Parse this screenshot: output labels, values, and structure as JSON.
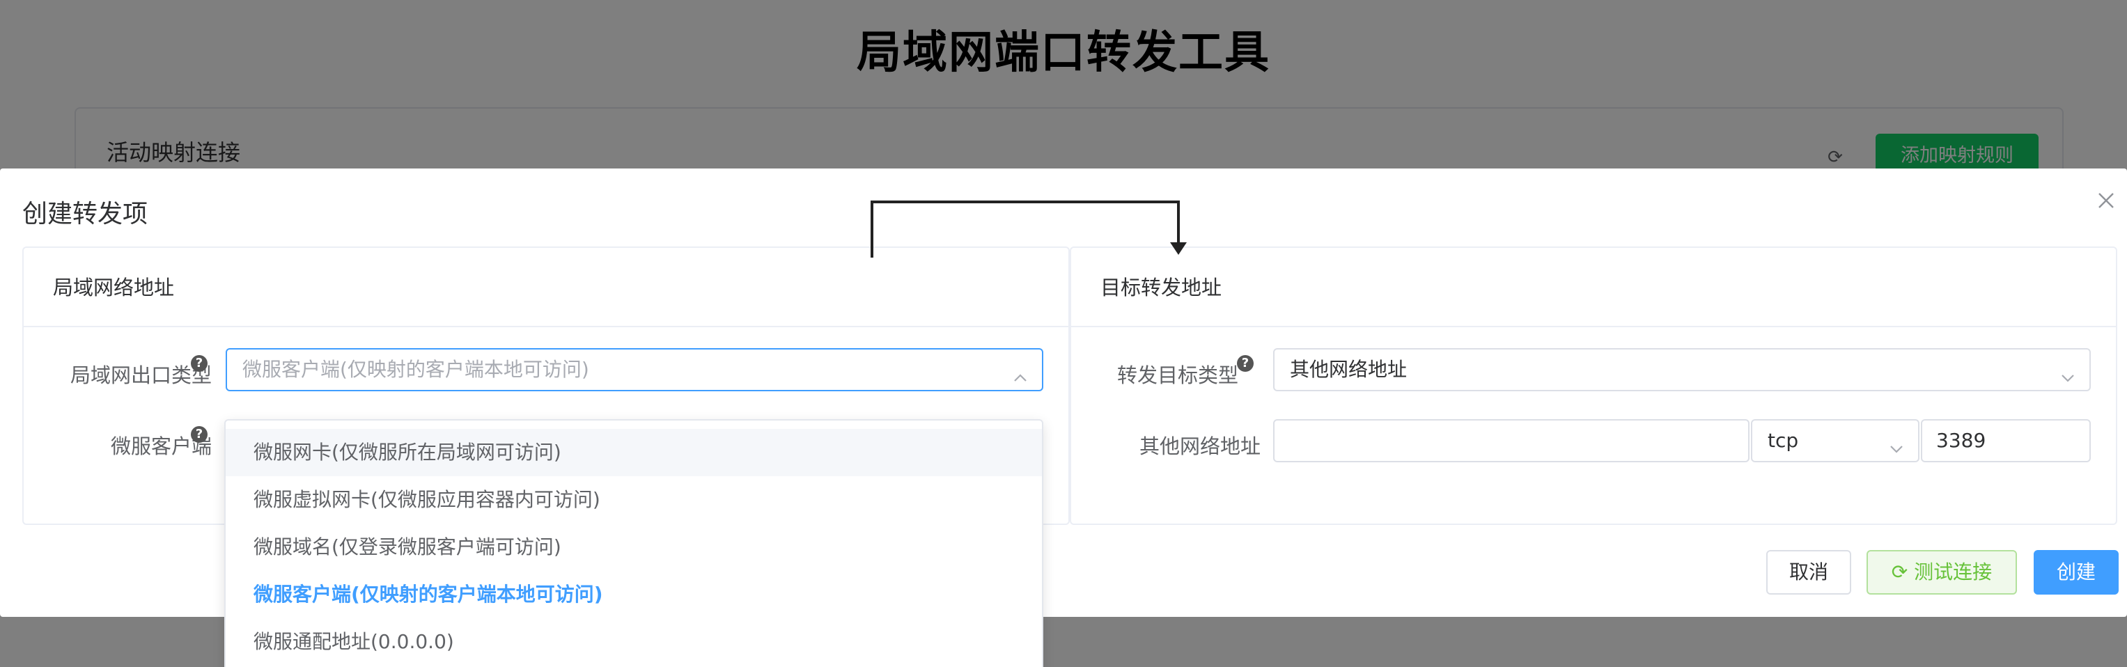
{
  "page": {
    "title": "局域网端口转发工具"
  },
  "connections_card": {
    "title": "活动映射连接",
    "add_rule_label": "添加映射规则",
    "refresh_icon": "refresh-icon"
  },
  "dialog": {
    "title": "创建转发项",
    "close_icon": "close-icon",
    "left_panel": {
      "title": "局域网络地址",
      "exit_type_label": "局域网出口类型",
      "exit_type_placeholder": "微服客户端(仅映射的客户端本地可访问)",
      "client_label": "微服客户端",
      "help_icon": "?"
    },
    "right_panel": {
      "title": "目标转发地址",
      "target_type_label": "转发目标类型",
      "target_type_value": "其他网络地址",
      "other_address_label": "其他网络地址",
      "other_address_value": "",
      "protocol_value": "tcp",
      "port_value": "3389",
      "help_icon": "?"
    },
    "footer": {
      "cancel_label": "取消",
      "test_label": "测试连接",
      "create_label": "创建"
    }
  },
  "dropdown": {
    "options": [
      "微服网卡(仅微服所在局域网可访问)",
      "微服虚拟网卡(仅微服应用容器内可访问)",
      "微服域名(仅登录微服客户端可访问)",
      "微服客户端(仅映射的客户端本地可访问)",
      "微服通配地址(0.0.0.0)"
    ],
    "hover_index": 0,
    "selected_index": 3
  },
  "colors": {
    "primary": "#409eff",
    "success": "#13ce66",
    "test_button_text": "#67c23a",
    "mask": "rgba(0,0,0,0.5)"
  }
}
